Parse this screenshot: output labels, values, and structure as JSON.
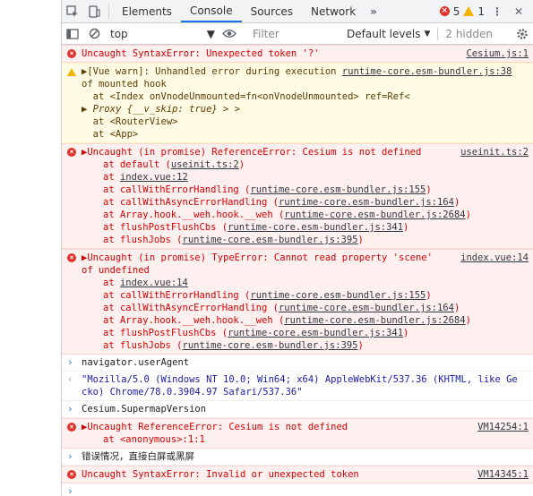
{
  "tabs": [
    "Elements",
    "Console",
    "Sources",
    "Network"
  ],
  "active_tab": "Console",
  "more_tabs": "»",
  "counters": {
    "errors": "5",
    "warnings": "1"
  },
  "toolbar": {
    "context": "top",
    "filter_placeholder": "Filter",
    "levels": "Default levels",
    "hidden": "2 hidden"
  },
  "messages": [
    {
      "type": "error",
      "text": "Uncaught SyntaxError: Unexpected token '?'",
      "source": "Cesium.js:1"
    },
    {
      "type": "warn",
      "line1": "▶[Vue warn]: Unhandled error during execution ",
      "line1_link": "runtime-core.esm-bundler.js:38",
      "line2": "of mounted hook",
      "line3": "  at <Index onVnodeUnmounted=fn<onVnodeUnmounted> ref=Ref<",
      "line4_a": "▶ ",
      "line4_b": "Proxy {__v_skip: true}",
      "line4_c": " > >",
      "line5": "  at <RouterView>",
      "line6": "  at <App>"
    },
    {
      "type": "error",
      "head": "▶Uncaught (in promise) ReferenceError: Cesium is not defined",
      "source": "useinit.ts:2",
      "stack": [
        {
          "pre": "at default (",
          "link": "useinit.ts:2",
          "post": ")"
        },
        {
          "pre": "at ",
          "link": "index.vue:12",
          "post": ""
        },
        {
          "pre": "at callWithErrorHandling (",
          "link": "runtime-core.esm-bundler.js:155",
          "post": ")"
        },
        {
          "pre": "at callWithAsyncErrorHandling (",
          "link": "runtime-core.esm-bundler.js:164",
          "post": ")"
        },
        {
          "pre": "at Array.hook.__weh.hook.__weh (",
          "link": "runtime-core.esm-bundler.js:2684",
          "post": ")"
        },
        {
          "pre": "at flushPostFlushCbs (",
          "link": "runtime-core.esm-bundler.js:341",
          "post": ")"
        },
        {
          "pre": "at flushJobs (",
          "link": "runtime-core.esm-bundler.js:395",
          "post": ")"
        }
      ]
    },
    {
      "type": "error",
      "head": "▶Uncaught (in promise) TypeError: Cannot read property 'scene'",
      "head2": "of undefined",
      "source": "index.vue:14",
      "stack": [
        {
          "pre": "at ",
          "link": "index.vue:14",
          "post": ""
        },
        {
          "pre": "at callWithErrorHandling (",
          "link": "runtime-core.esm-bundler.js:155",
          "post": ")"
        },
        {
          "pre": "at callWithAsyncErrorHandling (",
          "link": "runtime-core.esm-bundler.js:164",
          "post": ")"
        },
        {
          "pre": "at Array.hook.__weh.hook.__weh (",
          "link": "runtime-core.esm-bundler.js:2684",
          "post": ")"
        },
        {
          "pre": "at flushPostFlushCbs (",
          "link": "runtime-core.esm-bundler.js:341",
          "post": ")"
        },
        {
          "pre": "at flushJobs (",
          "link": "runtime-core.esm-bundler.js:395",
          "post": ")"
        }
      ]
    },
    {
      "type": "input",
      "text": "navigator.userAgent"
    },
    {
      "type": "output",
      "line1": "\"Mozilla/5.0 (Windows NT 10.0; Win64; x64) AppleWebKit/537.36 (KHTML, like Ge",
      "line2": "cko) Chrome/78.0.3904.97 Safari/537.36\""
    },
    {
      "type": "input",
      "text": "Cesium.SupermapVersion"
    },
    {
      "type": "error",
      "head": "▶Uncaught ReferenceError: Cesium is not defined",
      "source": "VM14254:1",
      "line2": "at <anonymous>:1:1"
    },
    {
      "type": "input",
      "text": "错误情况，直接白屏或黑屏"
    },
    {
      "type": "error",
      "text": "Uncaught SyntaxError: Invalid or unexpected token",
      "source": "VM14345:1"
    }
  ],
  "prompt_symbol": "›"
}
